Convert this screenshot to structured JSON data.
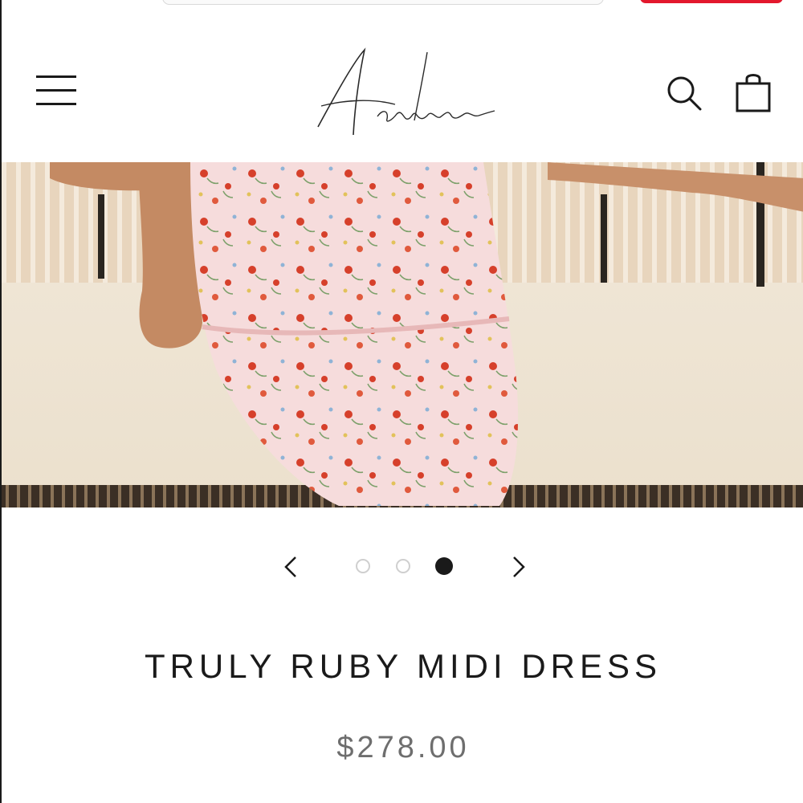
{
  "header": {
    "logo_text": "Adeirlina",
    "menu_icon": "hamburger-menu-icon",
    "search_icon": "search-icon",
    "cart_icon": "shopping-bag-icon"
  },
  "hero": {
    "image_description": "product-photo"
  },
  "carousel": {
    "prev_icon": "chevron-left-icon",
    "next_icon": "chevron-right-icon",
    "slide_count": 3,
    "active_index": 2
  },
  "product": {
    "title": "TRULY RUBY MIDI DRESS",
    "price": "$278.00"
  },
  "colors": {
    "accent_red": "#e3182d",
    "text_dark": "#1a1a1a",
    "price_gray": "#6e6e6e"
  }
}
